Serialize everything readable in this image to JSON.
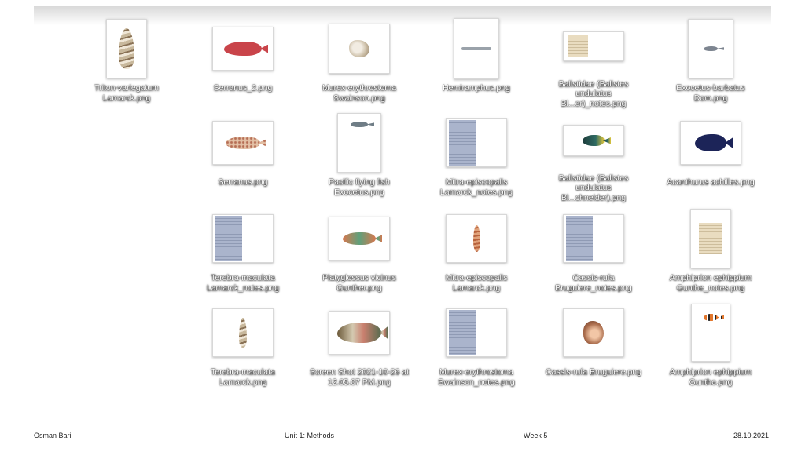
{
  "files": [
    {
      "name": "Triton-variegatum Lamarck.png",
      "thumb": "shell"
    },
    {
      "name": "Serranus_2.png",
      "thumb": "fish-red"
    },
    {
      "name": "Murex-erythrostoma Swainson.png",
      "thumb": "conch"
    },
    {
      "name": "Hemiramphus.png",
      "thumb": "needle"
    },
    {
      "name": "Balistidae (Balistes undulatus Bl...er)_notes.png",
      "thumb": "notes-tan-wide"
    },
    {
      "name": "Exocetus-barbatus Dom.png",
      "thumb": "flyingfish-portrait"
    },
    {
      "name": "Serranus.png",
      "thumb": "fish-spotted"
    },
    {
      "name": "Pacific flying fish Exocetus.png",
      "thumb": "flyingfish-portrait"
    },
    {
      "name": "Mitra-episcopalis Lamarck_notes.png",
      "thumb": "notes-blue"
    },
    {
      "name": "Balistidae (Balistes undulatus Bl...chneider).png",
      "thumb": "fish-trigger"
    },
    {
      "name": "Acanthurus achilles.png",
      "thumb": "fish-navy"
    },
    {
      "name": "Terebra-maculata Lamarck_notes.png",
      "thumb": "notes-blue"
    },
    {
      "name": "Platyglossus vicinus Gunther.png",
      "thumb": "fish-wrasse"
    },
    {
      "name": "Mitra-episcopalis Lamarck.png",
      "thumb": "spindle"
    },
    {
      "name": "Cassis-rufa Bruguiere_notes.png",
      "thumb": "notes-blue"
    },
    {
      "name": "Amphiprion ephippium Gunthe_notes.png",
      "thumb": "notes-tan-portrait"
    },
    {
      "name": "Terebra-maculata Lamarck.png",
      "thumb": "shell-small"
    },
    {
      "name": "Screen Shot 2021-10-26 at 12.05.07 PM.png",
      "thumb": "fish-wrasse-big"
    },
    {
      "name": "Murex-erythrostoma Swainson_notes.png",
      "thumb": "notes-blue"
    },
    {
      "name": "Cassis-rufa Bruguiere.png",
      "thumb": "cassis"
    },
    {
      "name": "Amphiprion ephippium Gunthe.png",
      "thumb": "clownfish-portrait"
    }
  ],
  "footer": {
    "author": "Osman Bari",
    "unit": "Unit 1: Methods",
    "week": "Week 5",
    "date": "28.10.2021"
  }
}
